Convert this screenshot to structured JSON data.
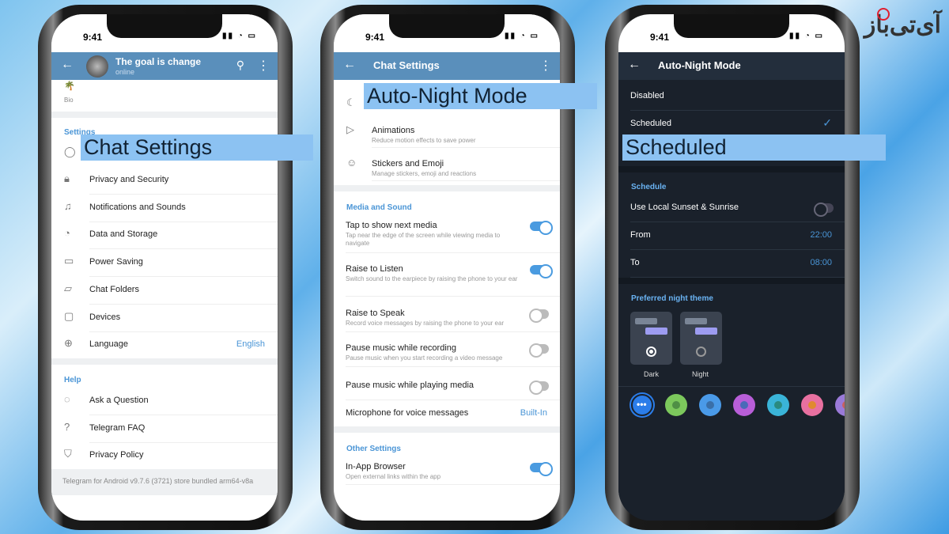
{
  "status_time": "9:41",
  "logo_text": "آی‌تی‌باز",
  "phone1": {
    "title": "The goal is change",
    "subtitle": "online",
    "bio_label": "Bio",
    "settings_header": "Settings",
    "highlight": "Chat Settings",
    "items": [
      {
        "icon": "privacy-lock-icon",
        "label": "Privacy and Security"
      },
      {
        "icon": "bell-icon",
        "label": "Notifications and Sounds"
      },
      {
        "icon": "pie-chart-icon",
        "label": "Data and Storage"
      },
      {
        "icon": "battery-icon",
        "label": "Power Saving"
      },
      {
        "icon": "folder-icon",
        "label": "Chat Folders"
      },
      {
        "icon": "devices-icon",
        "label": "Devices"
      },
      {
        "icon": "globe-icon",
        "label": "Language",
        "value": "English"
      }
    ],
    "help_header": "Help",
    "help_items": [
      {
        "icon": "chat-bubble-icon",
        "label": "Ask a Question"
      },
      {
        "icon": "question-icon",
        "label": "Telegram FAQ"
      },
      {
        "icon": "shield-icon",
        "label": "Privacy Policy"
      }
    ],
    "footer": "Telegram for Android v9.7.6 (3721) store bundled arm64-v8a"
  },
  "phone2": {
    "title": "Chat Settings",
    "highlight": "Auto-Night Mode",
    "top_items": [
      {
        "icon": "play-icon",
        "label": "Animations",
        "sub": "Reduce motion effects to save power"
      },
      {
        "icon": "sticker-icon",
        "label": "Stickers and Emoji",
        "sub": "Manage stickers, emoji and reactions"
      }
    ],
    "media_header": "Media and Sound",
    "media_items": [
      {
        "label": "Tap to show next media",
        "sub": "Tap near the edge of the screen while viewing media to navigate",
        "toggle": true
      },
      {
        "label": "Raise to Listen",
        "sub": "Switch sound to the earpiece by raising the phone to your ear",
        "toggle": true
      },
      {
        "label": "Raise to Speak",
        "sub": "Record voice messages by raising the phone to your ear",
        "toggle": false
      },
      {
        "label": "Pause music while recording",
        "sub": "Pause music when you start recording a video message",
        "toggle": false
      },
      {
        "label": "Pause music while playing media",
        "toggle": false
      },
      {
        "label": "Microphone for voice messages",
        "value": "Built-In"
      }
    ],
    "other_header": "Other Settings",
    "other_items": [
      {
        "label": "In-App Browser",
        "sub": "Open external links within the app",
        "toggle": true
      }
    ]
  },
  "phone3": {
    "title": "Auto-Night Mode",
    "modes": [
      {
        "label": "Disabled"
      },
      {
        "label": "Scheduled",
        "checked": true
      }
    ],
    "highlight": "Scheduled",
    "schedule_header": "Schedule",
    "schedule_items": [
      {
        "label": "Use Local Sunset & Sunrise",
        "toggle": false
      },
      {
        "label": "From",
        "value": "22:00"
      },
      {
        "label": "To",
        "value": "08:00"
      }
    ],
    "theme_header": "Preferred night theme",
    "themes": [
      {
        "label": "Dark",
        "selected": true
      },
      {
        "label": "Night",
        "selected": false
      }
    ],
    "accent_colors": [
      {
        "outer": "#2b7de9",
        "inner": "#ffffff"
      },
      {
        "outer": "#7cc85c",
        "inner": "#4f8f45"
      },
      {
        "outer": "#4a9ae8",
        "inner": "#3a6fa8"
      },
      {
        "outer": "#b85ed8",
        "inner": "#4a6ab8"
      },
      {
        "outer": "#3ab4d8",
        "inner": "#2a8a80"
      },
      {
        "outer": "#e870a0",
        "inner": "#e08a30"
      },
      {
        "outer": "#9a7ad8",
        "inner": "#c86060"
      }
    ]
  }
}
